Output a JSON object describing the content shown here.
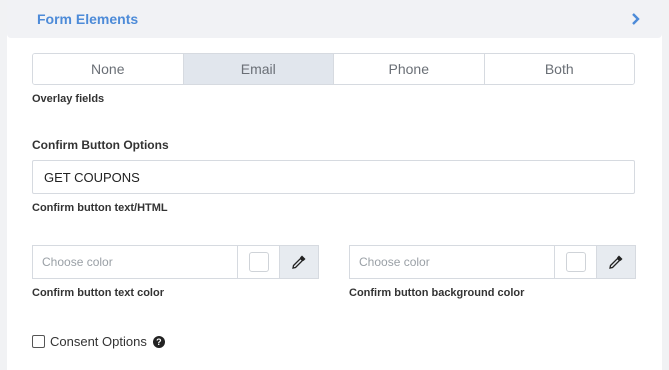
{
  "panel": {
    "title": "Form Elements",
    "expand_icon": "chevron-right-icon",
    "title_color": "#4d8bd8"
  },
  "overlay_fields": {
    "options": [
      "None",
      "Email",
      "Phone",
      "Both"
    ],
    "selected": "Email",
    "label": "Overlay fields"
  },
  "confirm_button": {
    "section_title": "Confirm Button Options",
    "text_value": "GET COUPONS",
    "text_label": "Confirm button text/HTML",
    "text_color": {
      "placeholder": "Choose color",
      "label": "Confirm button text color",
      "picker_icon": "eyedropper-icon"
    },
    "background_color": {
      "placeholder": "Choose color",
      "label": "Confirm button background color",
      "picker_icon": "eyedropper-icon"
    }
  },
  "consent": {
    "label": "Consent Options",
    "checked": false,
    "help_icon": "question-circle-icon"
  }
}
